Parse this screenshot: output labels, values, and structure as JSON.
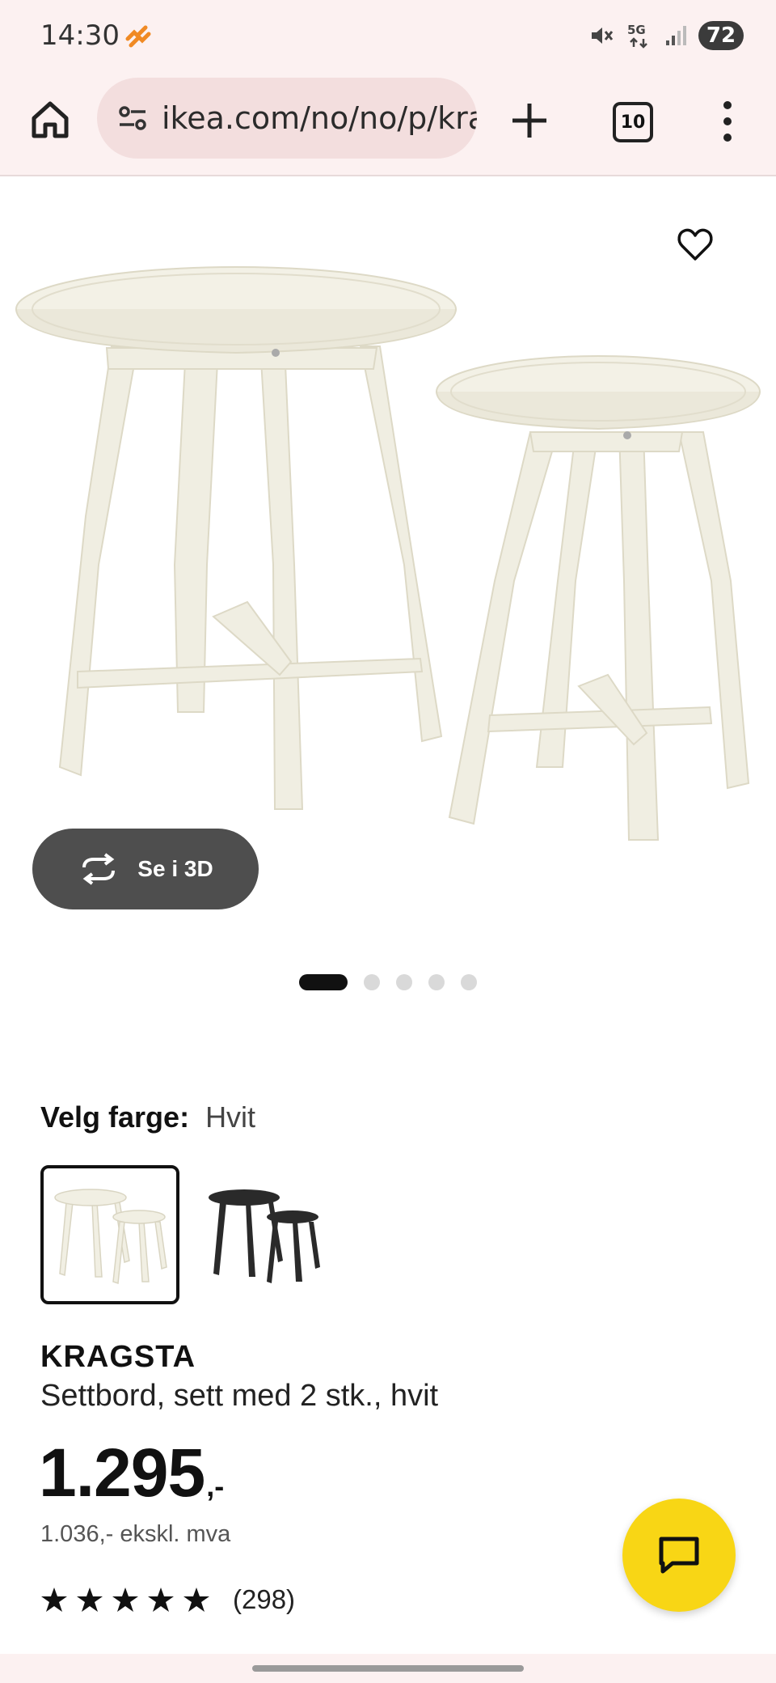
{
  "status_bar": {
    "time": "14:30",
    "battery": "72",
    "network": "5G"
  },
  "browser": {
    "url": "ikea.com/no/no/p/kra",
    "tab_count": "10"
  },
  "product": {
    "view_3d_label": "Se i 3D",
    "image_count": 5,
    "active_image_index": 0,
    "color_label": "Velg farge:",
    "color_value": "Hvit",
    "color_options": [
      "hvit",
      "svart"
    ],
    "selected_color_index": 0,
    "name": "KRAGSTA",
    "description": "Settbord, sett med 2 stk., hvit",
    "price": "1.295",
    "price_suffix": ",-",
    "price_ex_vat": "1.036,- ekskl. mva",
    "rating_stars": 5,
    "rating_count": "(298)"
  },
  "colors": {
    "status_bg": "#fcf1f1",
    "url_bg": "#f3dede",
    "button_3d_bg": "#4e4e4e",
    "chat_fab": "#f8d615",
    "table_white": "#f1efe3",
    "table_black": "#2a2a2a"
  },
  "icons": {
    "home": "home-icon",
    "site_settings": "tune-icon",
    "new_tab": "plus-icon",
    "menu": "more-vert-icon",
    "favorite": "heart-icon",
    "rotate_3d": "rotate-3d-icon",
    "chat": "chat-icon",
    "star": "star-icon"
  }
}
